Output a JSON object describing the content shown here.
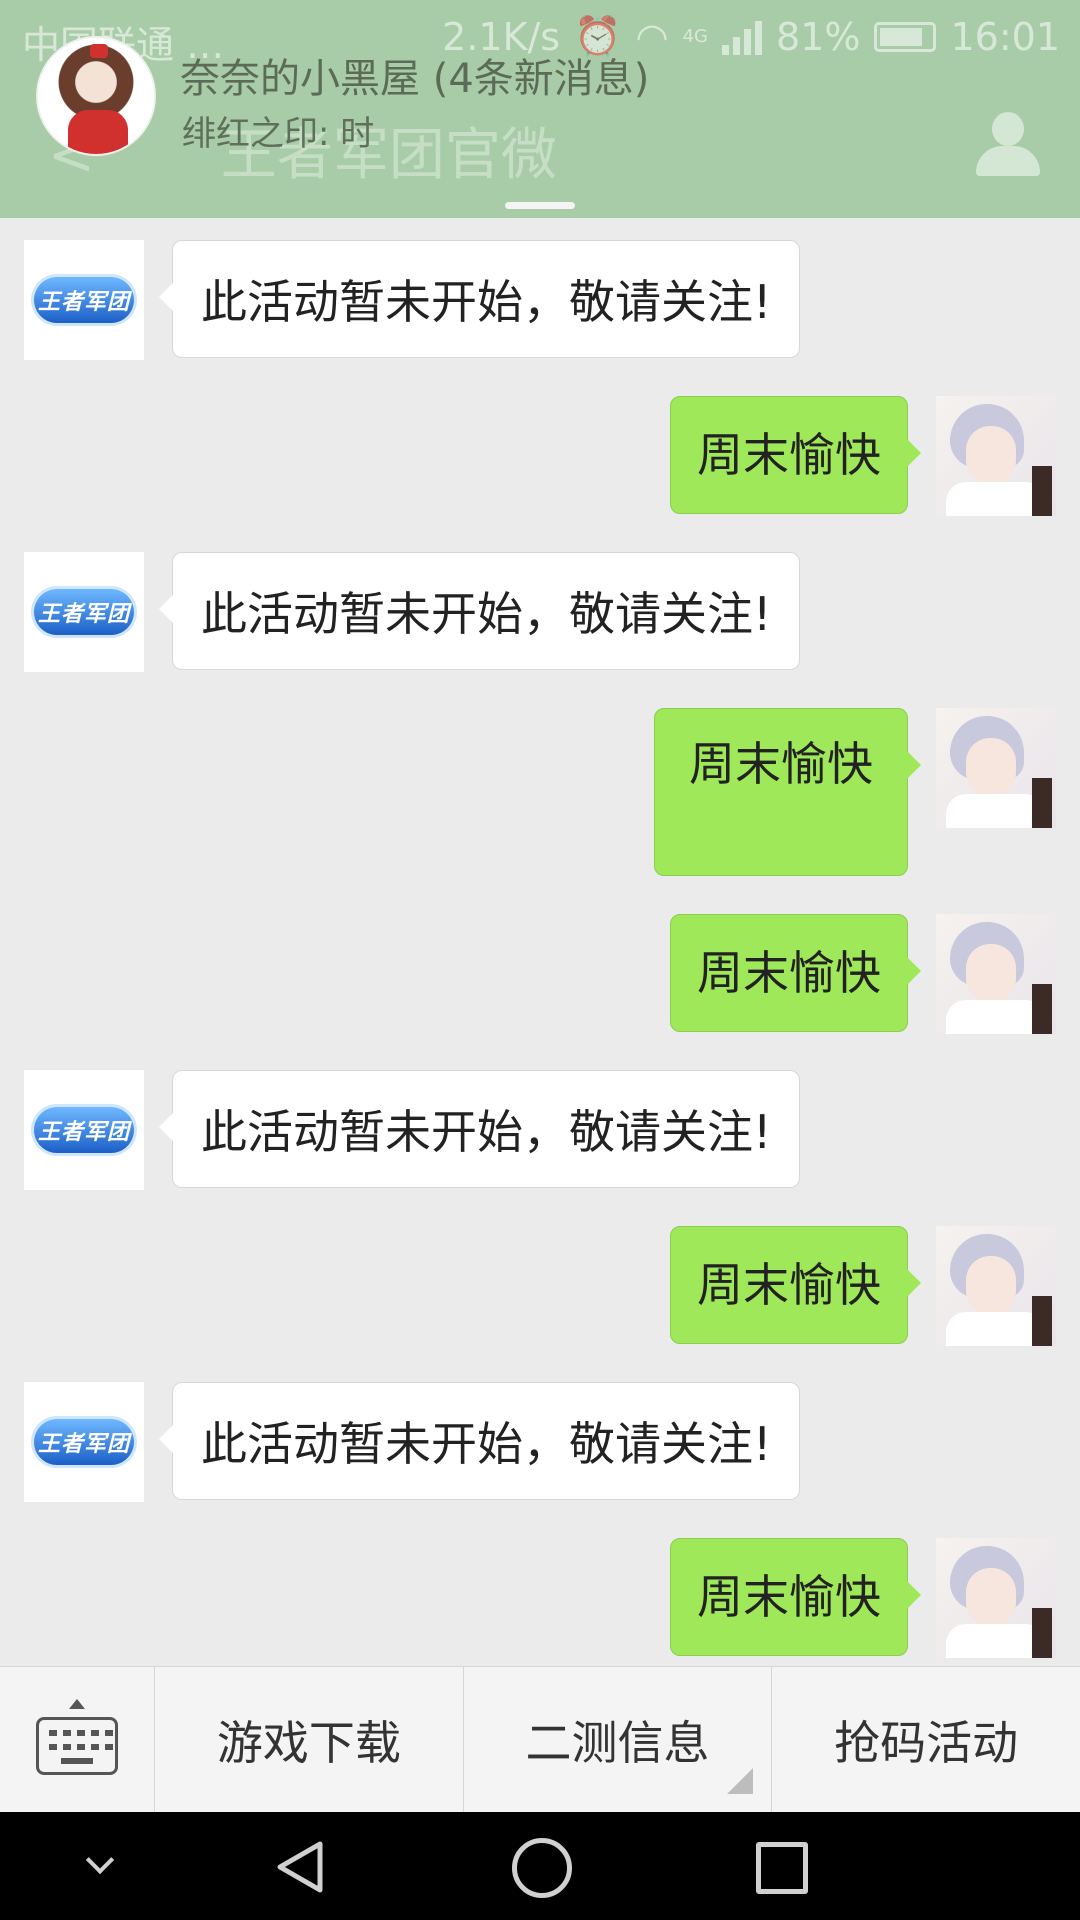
{
  "status_bar": {
    "carrier": "中国联通 …",
    "net_speed": "2.1K/s",
    "network_type": "4G",
    "battery": "81%",
    "time": "16:01"
  },
  "title_bar": {
    "back_glyph": "<",
    "chat_name": "王者军团官微",
    "profile_icon": "person-icon"
  },
  "notification": {
    "title": "奈奈的小黑屋 (4条新消息)",
    "text": "绯红之印: 时"
  },
  "messages": [
    {
      "side": "in",
      "text": "此活动暂未开始，敬请关注!"
    },
    {
      "side": "out",
      "text": "周末愉快"
    },
    {
      "side": "in",
      "text": "此活动暂未开始，敬请关注!"
    },
    {
      "side": "out",
      "text": "周末愉快"
    },
    {
      "side": "out",
      "text": "周末愉快"
    },
    {
      "side": "in",
      "text": "此活动暂未开始，敬请关注!"
    },
    {
      "side": "out",
      "text": "周末愉快"
    },
    {
      "side": "in",
      "text": "此活动暂未开始，敬请关注!"
    },
    {
      "side": "out",
      "text": "周末愉快"
    }
  ],
  "official_logo_text": "王者军团",
  "menu": {
    "keyboard_icon": "keyboard-icon",
    "items": [
      "游戏下载",
      "二测信息",
      "抢码活动"
    ]
  },
  "colors": {
    "header": "#a9cca8",
    "outgoing_bubble": "#9fe85a",
    "incoming_bubble": "#ffffff",
    "chat_background": "#ebebeb"
  }
}
